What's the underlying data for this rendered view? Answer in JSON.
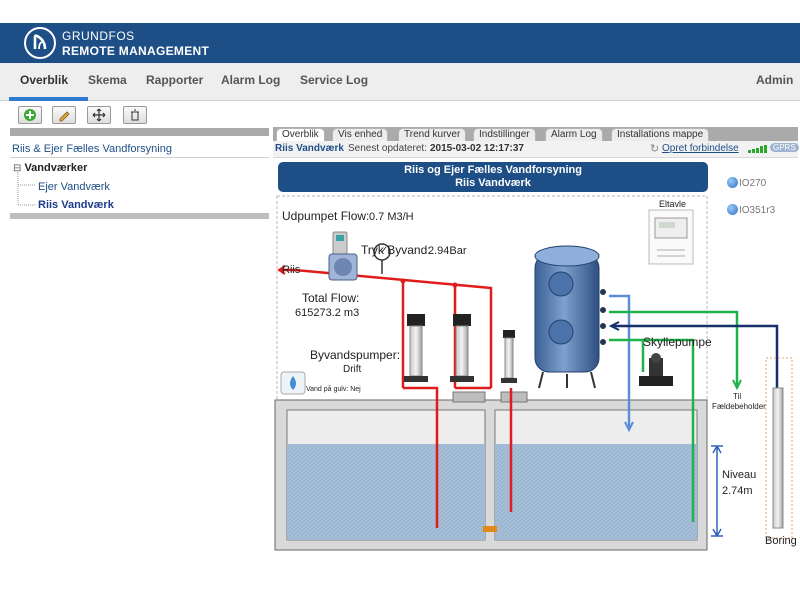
{
  "brand": {
    "line1": "GRUNDFOS",
    "line2": "REMOTE MANAGEMENT"
  },
  "nav": {
    "items": [
      "Overblik",
      "Skema",
      "Rapporter",
      "Alarm Log",
      "Service Log"
    ],
    "admin": "Admin"
  },
  "toolbar": {
    "icons": [
      "add-icon",
      "edit-icon",
      "move-icon",
      "delete-icon"
    ]
  },
  "left": {
    "title": "Riis & Ejer Fælles Vandforsyning",
    "tree_root": "Vandværker",
    "tree_children": [
      "Ejer Vandværk",
      "Riis Vandværk"
    ]
  },
  "tabs": [
    "Overblik",
    "Vis enhed",
    "Trend kurver",
    "Indstillinger",
    "Alarm Log",
    "Installations mappe"
  ],
  "info": {
    "site": "Riis Vandværk",
    "updated_label": "Senest opdateret:",
    "updated_value": "2015-03-02 12:17:37",
    "connect_label": "Opret forbindelse",
    "signal_label": "GPRS"
  },
  "title_box": {
    "line1": "Riis og Ejer Fælles Vandforsyning",
    "line2": "Riis Vandværk"
  },
  "io": [
    "IO270",
    "IO351r3"
  ],
  "diagram": {
    "udpumpet_label": "Udpumpet Flow:",
    "udpumpet_value": "0.7 M3/H",
    "eltavle": "Eltavle",
    "tryk_label": "Tryk Byvand:",
    "tryk_value": "2.94Bar",
    "riis": "Riis",
    "total_flow_label": "Total Flow:",
    "total_flow_value": "615273.2 m3",
    "byvand_label": "Byvandspumper:",
    "byvand_value": "Drift",
    "skylle": "Skyllepumpe",
    "til1": "Til",
    "til2": "Fældebeholder",
    "vand_label": "Vand på gulv: Nej",
    "niveau_label": "Niveau",
    "niveau_value": "2.74m",
    "boring": "Boring"
  },
  "colors": {
    "header": "#1d4f86",
    "accent": "#2f7bd0",
    "pipe_red": "#e01b1b",
    "pipe_green": "#1db34a",
    "pipe_blue": "#5a8fd6",
    "pipe_navy": "#16306b",
    "water": "#a6bfd9"
  }
}
